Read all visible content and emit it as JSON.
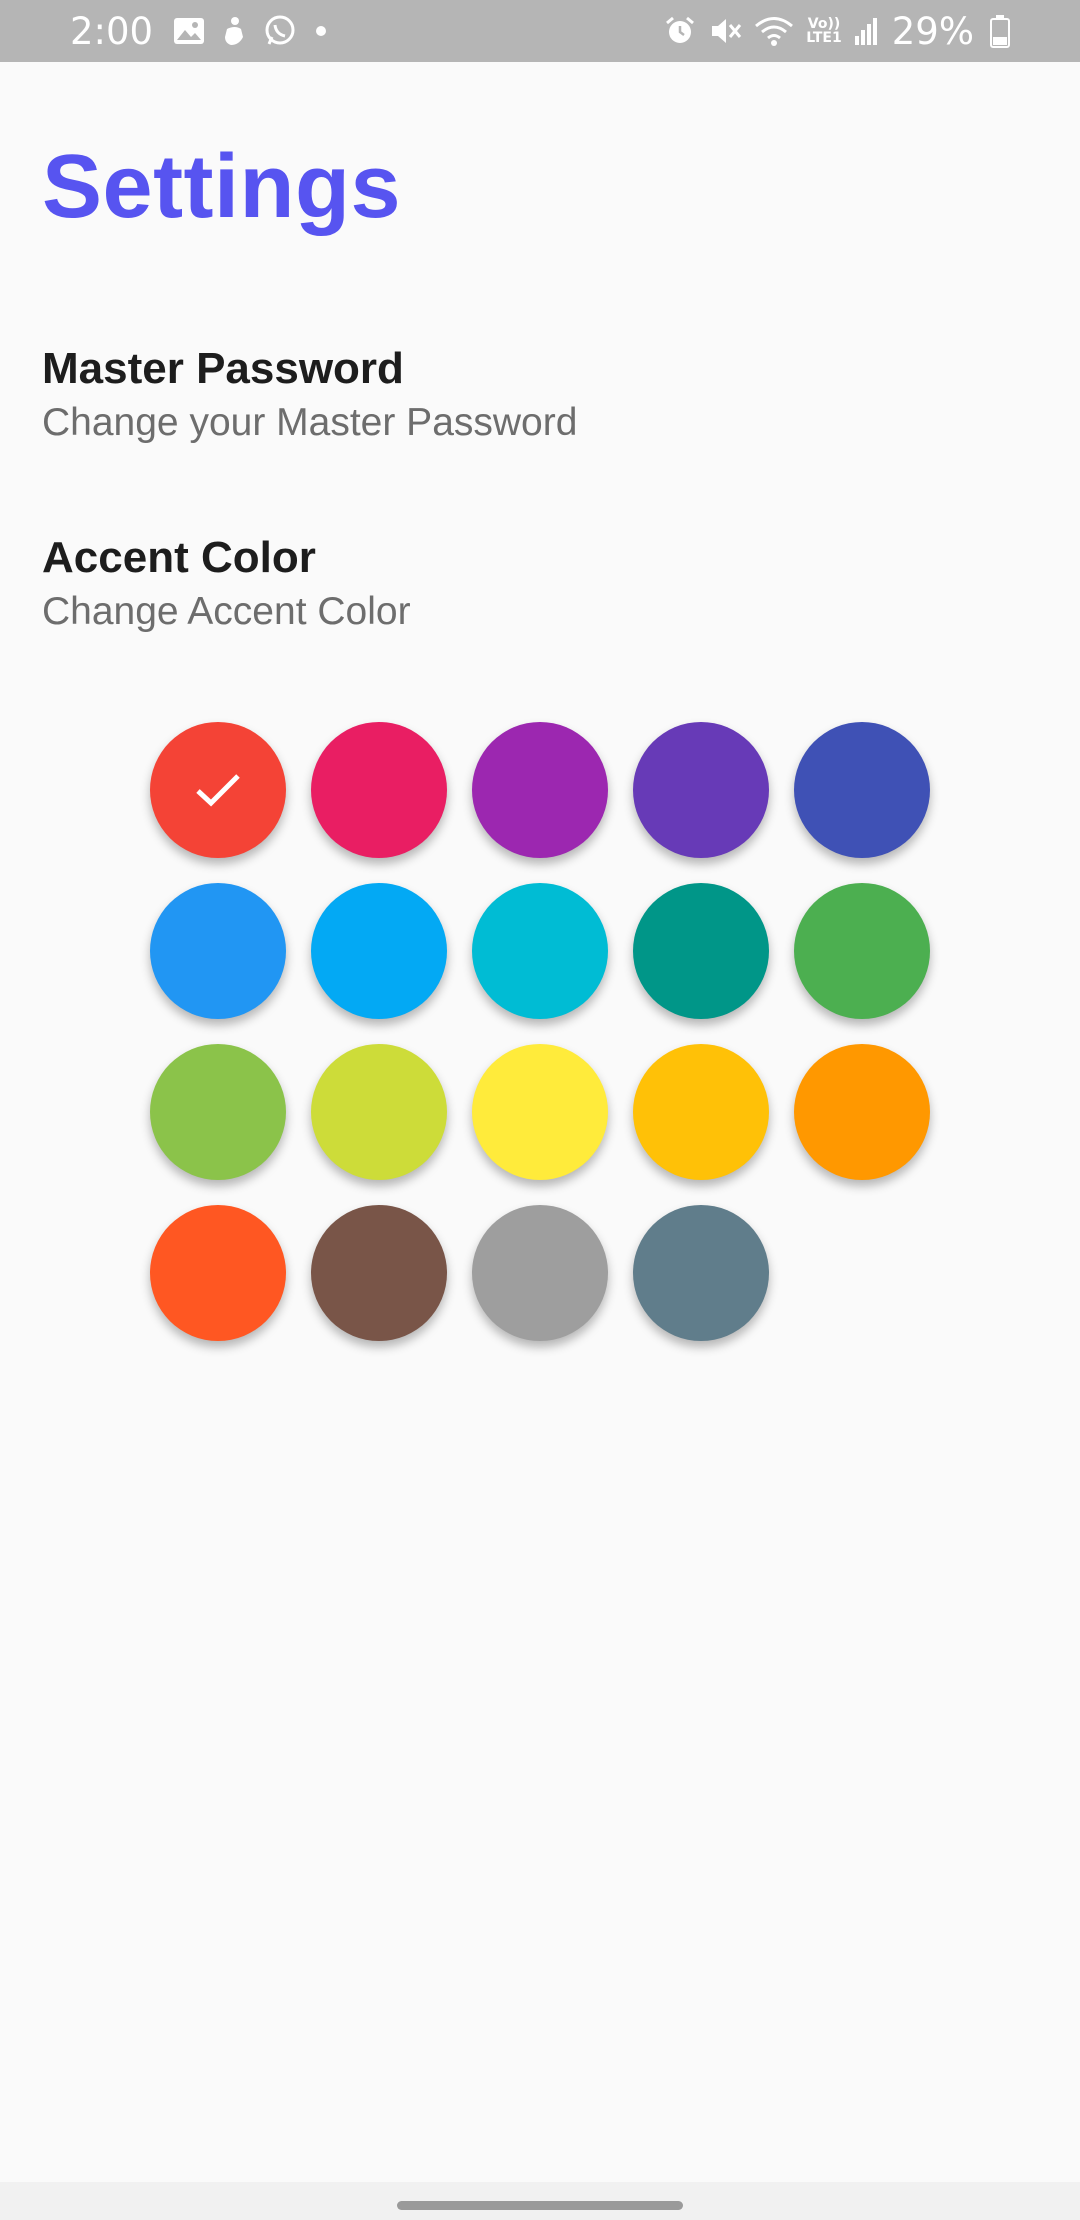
{
  "status_bar": {
    "time": "2:00",
    "battery": "29%",
    "volte_top": "Vo))",
    "volte_bottom": "LTE1",
    "icons_left": [
      "image-icon",
      "hand-icon",
      "whatsapp-icon",
      "dot-icon"
    ],
    "icons_right": [
      "alarm-icon",
      "mute-icon",
      "wifi-icon",
      "volte-icon",
      "signal-icon",
      "battery-icon"
    ]
  },
  "page": {
    "title": "Settings"
  },
  "settings": {
    "master_password": {
      "title": "Master Password",
      "subtitle": "Change your Master Password"
    },
    "accent_color": {
      "title": "Accent Color",
      "subtitle": "Change Accent Color"
    }
  },
  "colors": {
    "title_color": "#5754f0",
    "selected_index": 0,
    "swatches": [
      "#f44336",
      "#e91e63",
      "#9c27b0",
      "#673ab7",
      "#3f51b5",
      "#2196f3",
      "#03a9f4",
      "#00bcd4",
      "#009688",
      "#4caf50",
      "#8bc34a",
      "#cddc39",
      "#ffeb3b",
      "#ffc107",
      "#ff9800",
      "#ff5722",
      "#795548",
      "#9e9e9e",
      "#607d8b"
    ]
  }
}
